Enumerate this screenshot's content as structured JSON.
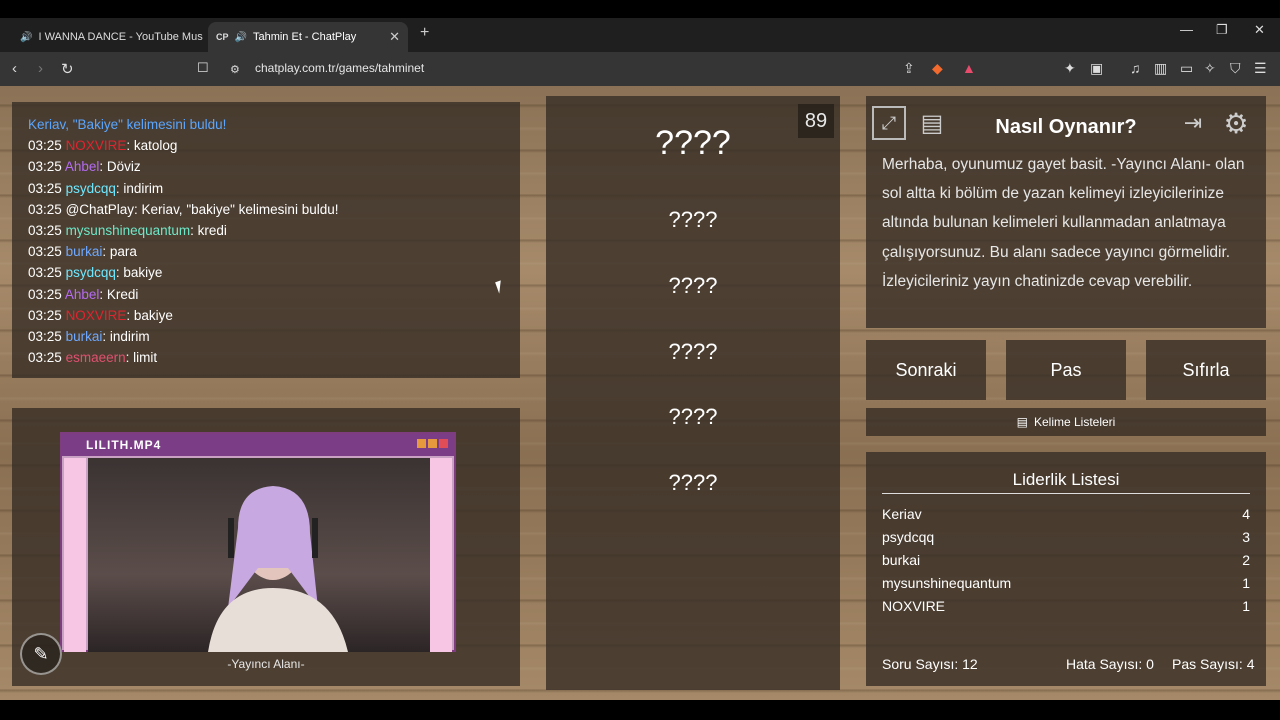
{
  "browser": {
    "tabs": [
      {
        "label": "I WANNA DANCE - YouTube Mus",
        "active": false,
        "icon": "youtube-music-icon"
      },
      {
        "label": "Tahmin Et - ChatPlay",
        "active": true,
        "icon": "chatplay-icon",
        "favicon_text": "CP"
      }
    ],
    "url": "chatplay.com.tr/games/tahminet"
  },
  "chat": {
    "header": "Keriav, \"Bakiye\" kelimesini buldu!",
    "messages": [
      {
        "time": "03:25",
        "user": "NOXVIRE",
        "text": ": katolog",
        "color": "#e0242f"
      },
      {
        "time": "03:25",
        "user": "Ahbel",
        "text": ": Döviz",
        "color": "#b46cf0"
      },
      {
        "time": "03:25",
        "user": "psydcqq",
        "text": ": indirim",
        "color": "#6ee8ff"
      },
      {
        "time": "03:25",
        "user": "@ChatPlay",
        "text": ": Keriav, \"bakiye\" kelimesini buldu!",
        "color": "#ffffff"
      },
      {
        "time": "03:25",
        "user": "mysunshinequantum",
        "text": ": kredi",
        "color": "#6ee8c8"
      },
      {
        "time": "03:25",
        "user": "burkai",
        "text": ": para",
        "color": "#6ea8ff"
      },
      {
        "time": "03:25",
        "user": "psydcqq",
        "text": ": bakiye",
        "color": "#6ee8ff"
      },
      {
        "time": "03:25",
        "user": "Ahbel",
        "text": ": Kredi",
        "color": "#b46cf0"
      },
      {
        "time": "03:25",
        "user": "NOXVIRE",
        "text": ": bakiye",
        "color": "#e0242f"
      },
      {
        "time": "03:25",
        "user": "burkai",
        "text": ": indirim",
        "color": "#6ea8ff"
      },
      {
        "time": "03:25",
        "user": "esmaeern",
        "text": ": limit",
        "color": "#e05070"
      }
    ]
  },
  "stream": {
    "window_title": "LILITH.MP4",
    "label": "-Yayıncı Alanı-"
  },
  "game": {
    "timer": "89",
    "main_word": "????",
    "words": [
      "????",
      "????",
      "????",
      "????",
      "????"
    ]
  },
  "help": {
    "title": "Nasıl Oynanır?",
    "text": "Merhaba, oyunumuz gayet basit. -Yayıncı Alanı- olan sol altta ki bölüm de yazan kelimeyi izleyicilerinize altında bulunan kelimeleri kullanmadan anlatmaya çalışıyorsunuz. Bu alanı sadece yayıncı görmelidir. İzleyicileriniz yayın chatinizde cevap verebilir."
  },
  "controls": {
    "next": "Sonraki",
    "pass": "Pas",
    "reset": "Sıfırla",
    "word_lists": "Kelime Listeleri"
  },
  "leaderboard": {
    "title": "Liderlik Listesi",
    "rows": [
      {
        "name": "Keriav",
        "score": "4"
      },
      {
        "name": "psydcqq",
        "score": "3"
      },
      {
        "name": "burkai",
        "score": "2"
      },
      {
        "name": "mysunshinequantum",
        "score": "1"
      },
      {
        "name": "NOXVIRE",
        "score": "1"
      }
    ]
  },
  "stats": {
    "questions": "Soru Sayısı: 12",
    "errors": "Hata Sayısı: 0",
    "passes": "Pas Sayısı: 4"
  }
}
